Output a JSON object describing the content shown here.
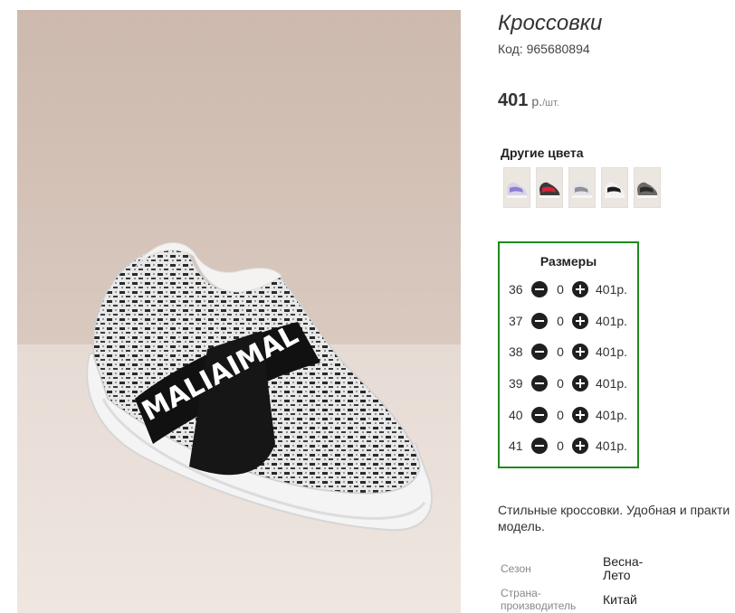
{
  "product": {
    "title": "Кроссовки",
    "code": "Код: 965680894",
    "price_value": "401",
    "price_currency": "р.",
    "price_unit": "/шт."
  },
  "colors": {
    "title": "Другие цвета",
    "swatches": [
      {
        "name": "lilac-blue",
        "accent": "#8c7fd0",
        "base": "#d7d3e8"
      },
      {
        "name": "red",
        "accent": "#d9233a",
        "base": "#3a3a3a"
      },
      {
        "name": "grey",
        "accent": "#8f8f98",
        "base": "#e4e4e8"
      },
      {
        "name": "black-white",
        "accent": "#1c1c1c",
        "base": "#f2f2f2"
      },
      {
        "name": "black",
        "accent": "#2a2a2a",
        "base": "#6a6a6a"
      }
    ]
  },
  "sizes": {
    "title": "Размеры",
    "rows": [
      {
        "size": "36",
        "qty": "0",
        "price": "401р."
      },
      {
        "size": "37",
        "qty": "0",
        "price": "401р."
      },
      {
        "size": "38",
        "qty": "0",
        "price": "401р."
      },
      {
        "size": "39",
        "qty": "0",
        "price": "401р."
      },
      {
        "size": "40",
        "qty": "0",
        "price": "401р."
      },
      {
        "size": "41",
        "qty": "0",
        "price": "401р."
      }
    ]
  },
  "description": {
    "line1": "Стильные кроссовки. Удобная и практи",
    "line2": "модель."
  },
  "attributes": [
    {
      "label": "Сезон",
      "value": "Весна-Лето"
    },
    {
      "label": "Страна-производитель",
      "value": "Китай"
    }
  ],
  "photo": {
    "strap_text": "MALIAIMAL"
  },
  "colors_theme": {
    "sizes_border": "#1e8a1e",
    "button": "#1f1f1f"
  }
}
